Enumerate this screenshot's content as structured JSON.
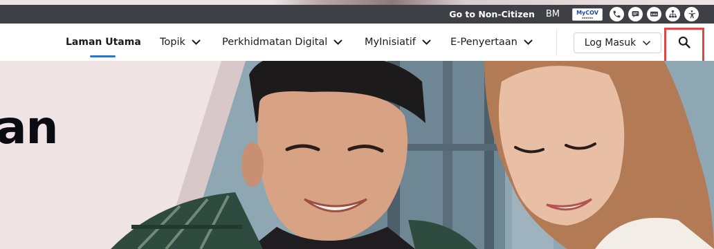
{
  "utility_bar": {
    "non_citizen_link": "Go to Non-Citizen",
    "language": "BM",
    "mycov_logo": "MyCOV",
    "icons": [
      "phone-icon",
      "feedback-icon",
      "sms-icon",
      "sitemap-icon",
      "accessibility-icon"
    ]
  },
  "nav": {
    "items": [
      {
        "label": "Laman Utama",
        "active": true
      },
      {
        "label": "Topik"
      },
      {
        "label": "Perkhidmatan Digital"
      },
      {
        "label": "MyInisiatif"
      },
      {
        "label": "E-Penyertaan"
      }
    ],
    "login_label": "Log Masuk"
  },
  "hero": {
    "title_fragment": "an"
  },
  "colors": {
    "utility_bg": "#3f3f46",
    "active_accent": "#2f73c9",
    "highlight_box": "#e14646"
  }
}
